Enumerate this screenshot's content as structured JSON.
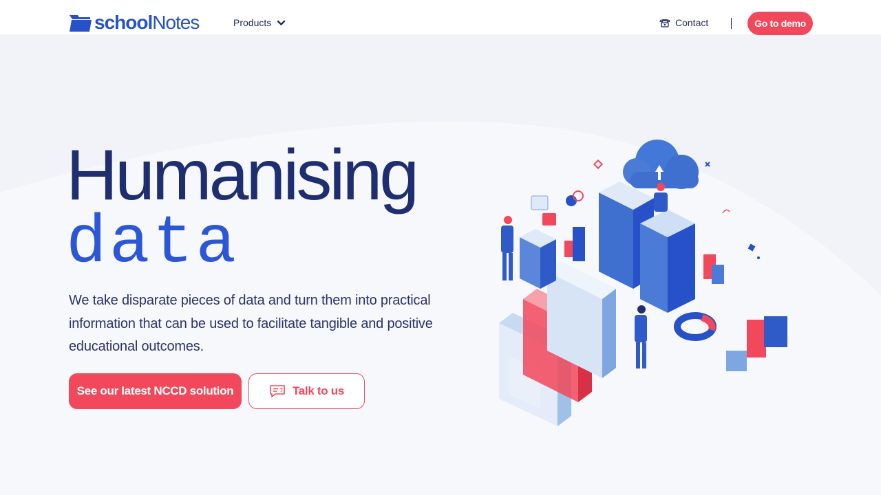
{
  "brand": {
    "name_bold": "school",
    "name_regular": "Notes",
    "primary_color": "#2651c9",
    "accent_color": "#f2485b"
  },
  "nav": {
    "products_label": "Products",
    "contact_label": "Contact",
    "demo_label": "Go to demo"
  },
  "hero": {
    "title": "Humanising",
    "subtitle": "data",
    "description": "We take disparate pieces of data and turn them into practical information that can be used to facilitate tangible and positive educational outcomes.",
    "primary_button": "See our latest NCCD solution",
    "secondary_button": "Talk to us"
  },
  "icons": {
    "logo": "folder-icon",
    "products_caret": "chevron-down-icon",
    "contact": "phone-icon",
    "talk": "chat-bubble-icon"
  }
}
